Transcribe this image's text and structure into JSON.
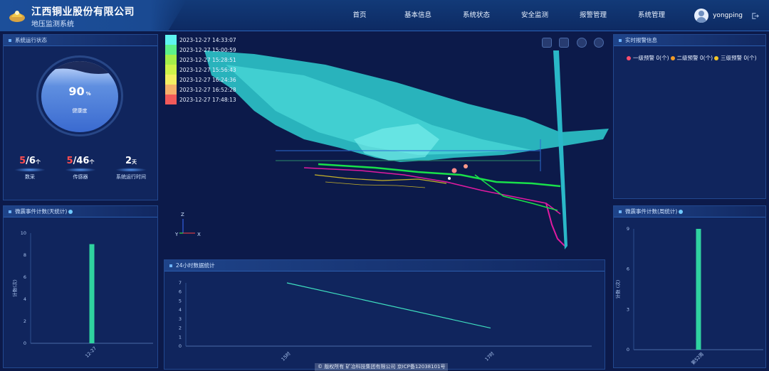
{
  "header": {
    "company": "江西铜业股份有限公司",
    "system": "地压监测系统",
    "nav": [
      "首页",
      "基本信息",
      "系统状态",
      "安全监测",
      "报警管理",
      "系统管理"
    ],
    "user": "yongping",
    "logout_icon": "logout-icon"
  },
  "status_panel": {
    "title": "系统运行状态",
    "gauge_value": "90",
    "gauge_unit": "%",
    "gauge_label": "健康度",
    "stats": [
      {
        "current": "5",
        "total": "/6",
        "unit": "个",
        "label": "数采"
      },
      {
        "current": "5",
        "total": "/46",
        "unit": "个",
        "label": "传感器"
      },
      {
        "current": "",
        "total": "2",
        "unit": "天",
        "label": "系统运行时间"
      }
    ]
  },
  "legend": {
    "items": [
      {
        "label": "2023-12-27 14:33:07",
        "color": "#5ef4f0"
      },
      {
        "label": "2023-12-27 15:00:59",
        "color": "#5cf08a"
      },
      {
        "label": "2023-12-27 15:28:51",
        "color": "#a4ee4a"
      },
      {
        "label": "2023-12-27 15:56:43",
        "color": "#cff24a"
      },
      {
        "label": "2023-12-27 16:24:36",
        "color": "#f4ee62"
      },
      {
        "label": "2023-12-27 16:52:28",
        "color": "#f6b06a"
      },
      {
        "label": "2023-12-27 17:48:13",
        "color": "#f25a5a"
      }
    ]
  },
  "axes_gizmo": {
    "z": "Z",
    "y": "Y",
    "x": "X"
  },
  "alarm_panel": {
    "title": "实时报警信息",
    "items": [
      {
        "label": "一级预警 0(个)",
        "color": "#ff4d6d"
      },
      {
        "label": "二级预警 0(个)",
        "color": "#f29b26"
      },
      {
        "label": "三级预警 0(个)",
        "color": "#f2c626"
      }
    ]
  },
  "left_chart_panel": {
    "title": "微震事件计数(天统计)"
  },
  "right_chart_panel": {
    "title": "微震事件计数(周统计)"
  },
  "bottom_chart_panel": {
    "title": "24小时数据统计"
  },
  "footer": "© 版权所有 矿冶科技集团有限公司 京ICP备12038101号",
  "chart_data": [
    {
      "type": "bar",
      "title": "微震事件计数(天统计)",
      "categories": [
        "12-27"
      ],
      "values": [
        9
      ],
      "ylabel": "计数(次)",
      "ylim": [
        0,
        10
      ],
      "yticks": [
        0,
        2,
        4,
        6,
        8,
        10
      ],
      "color": "#2fd3a0"
    },
    {
      "type": "bar",
      "title": "微震事件计数(周统计)",
      "categories": [
        "第52周"
      ],
      "values": [
        9
      ],
      "ylabel": "计数 (次)",
      "ylim": [
        0,
        9
      ],
      "yticks": [
        0,
        3,
        6,
        9
      ],
      "color": "#2fd3a0"
    },
    {
      "type": "line",
      "title": "24小时数据统计",
      "x": [
        "15时",
        "17时"
      ],
      "values": [
        7,
        2
      ],
      "ylim": [
        0,
        7
      ],
      "yticks": [
        0,
        1,
        2,
        3,
        4,
        5,
        6,
        7
      ],
      "color": "#3fe0c0"
    }
  ]
}
